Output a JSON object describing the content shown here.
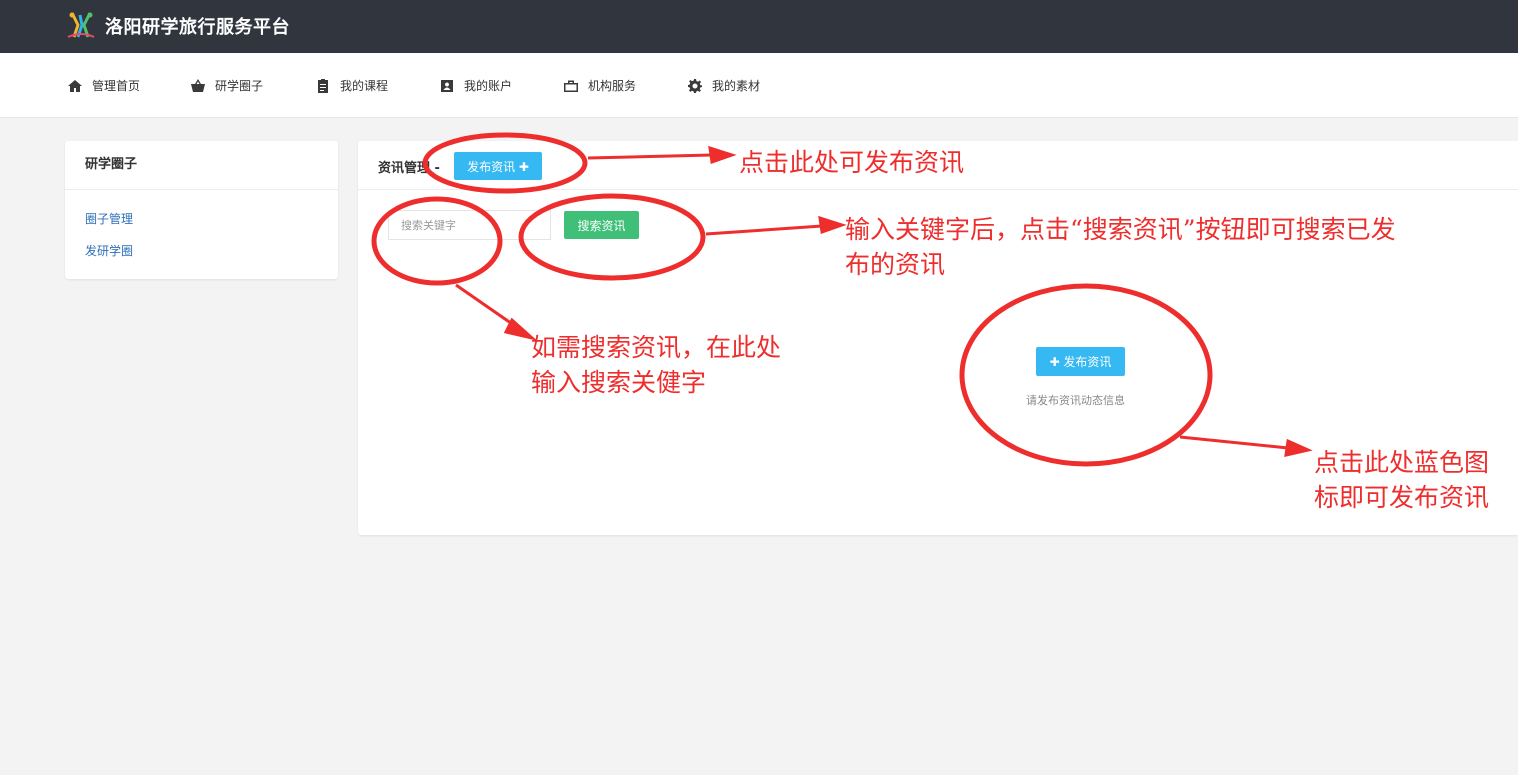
{
  "header": {
    "logo_icon": "colorful-people-logo",
    "site_title": "洛阳研学旅行服务平台",
    "background": "#30353e"
  },
  "nav": {
    "items": [
      {
        "label": "管理首页",
        "icon": "home-icon"
      },
      {
        "label": "研学圈子",
        "icon": "basket-icon"
      },
      {
        "label": "我的课程",
        "icon": "clipboard-icon"
      },
      {
        "label": "我的账户",
        "icon": "account-icon"
      },
      {
        "label": "机构服务",
        "icon": "briefcase-icon"
      },
      {
        "label": "我的素材",
        "icon": "gear-icon"
      }
    ]
  },
  "sidebar": {
    "title": "研学圈子",
    "links": [
      {
        "label": "圈子管理"
      },
      {
        "label": "发研学圈"
      }
    ]
  },
  "main": {
    "title": "资讯管理 -",
    "publish_button": "发布资讯 ✚",
    "search_placeholder": "搜索关键字",
    "search_button": "搜索资讯",
    "center_publish_button": "✚ 发布资讯",
    "empty_hint": "请发布资讯动态信息"
  },
  "annotations": {
    "publish_top": "点击此处可发布资讯",
    "search_button_line1": "输入关键字后，点击“搜索资讯”按钮即可搜索已发",
    "search_button_line2": "布的资讯",
    "search_input_line1": "如需搜索资讯，在此处",
    "search_input_line2": "输入搜索关健字",
    "center_button_line1": "点击此处蓝色图",
    "center_button_line2": "标即可发布资讯"
  },
  "colors": {
    "annotation_red": "#ee2d2d",
    "blue_button": "#36b9f2",
    "green_button": "#3fbf78",
    "link_blue": "#2d6fb7"
  }
}
